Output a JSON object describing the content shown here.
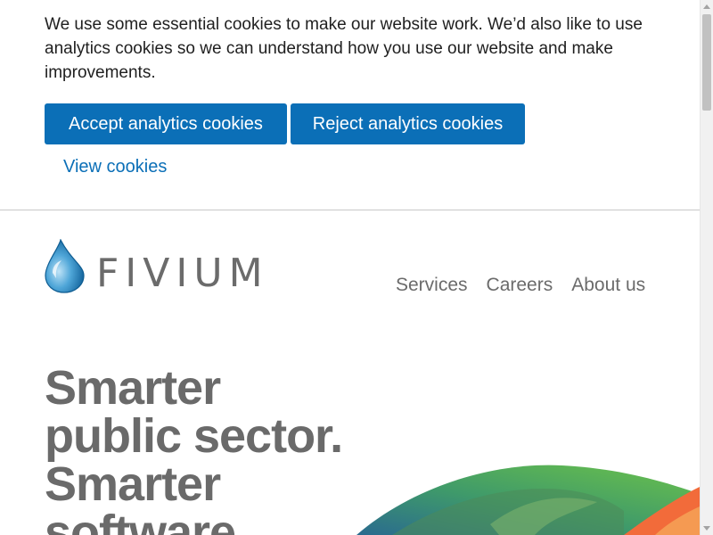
{
  "cookie_banner": {
    "message": "We use some essential cookies to make our website work. We’d also like to use analytics cookies so we can understand how you use our website and make improvements.",
    "accept_label": "Accept analytics cookies",
    "reject_label": "Reject analytics cookies",
    "view_label": "View cookies"
  },
  "header": {
    "logo_text": "FIVIUM",
    "nav": {
      "services": "Services",
      "careers": "Careers",
      "about": "About us"
    }
  },
  "hero": {
    "lines": [
      "Smarter",
      "public sector.",
      "Smarter",
      "software."
    ]
  },
  "colors": {
    "primary_button": "#0b6fb7",
    "link": "#0b6fb7",
    "nav_text": "#6b6b6b",
    "hero_text": "#6a6a6a",
    "hero_art_green": "#6cc24a",
    "hero_art_blue": "#2a6b8f",
    "hero_art_orange": "#f26b3a"
  }
}
